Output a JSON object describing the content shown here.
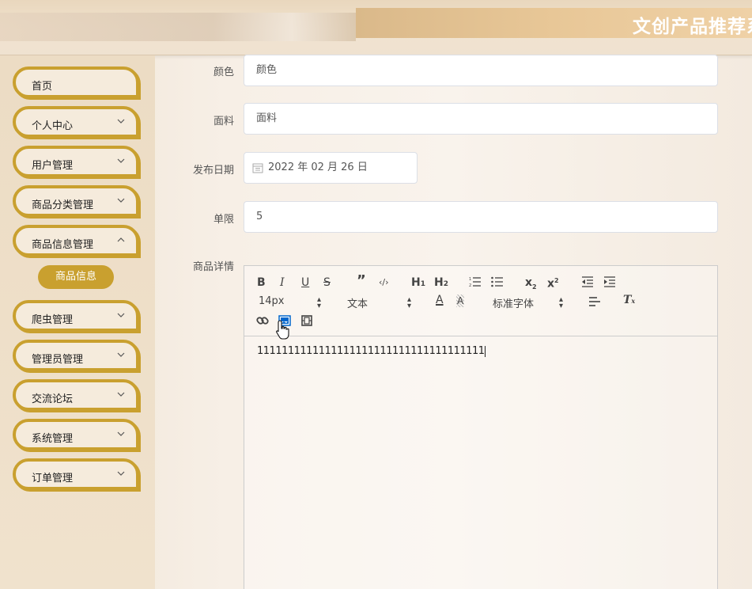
{
  "header": {
    "title": "文创产品推荐系统"
  },
  "sidebar": {
    "items": [
      {
        "label": "首页",
        "has_arrow": false
      },
      {
        "label": "个人中心",
        "has_arrow": true
      },
      {
        "label": "用户管理",
        "has_arrow": true
      },
      {
        "label": "商品分类管理",
        "has_arrow": true
      },
      {
        "label": "商品信息管理",
        "has_arrow": true
      },
      {
        "label": "爬虫管理",
        "has_arrow": true
      },
      {
        "label": "管理员管理",
        "has_arrow": true
      },
      {
        "label": "交流论坛",
        "has_arrow": true
      },
      {
        "label": "系统管理",
        "has_arrow": true
      },
      {
        "label": "订单管理",
        "has_arrow": true
      }
    ],
    "sub_item": "商品信息"
  },
  "form": {
    "color": {
      "label": "颜色",
      "value": "颜色"
    },
    "fabric": {
      "label": "面料",
      "value": "面料"
    },
    "release_date": {
      "label": "发布日期",
      "value": "2022 年 02 月 26 日"
    },
    "limit": {
      "label": "单限",
      "value": "5"
    },
    "detail": {
      "label": "商品详情"
    }
  },
  "editor": {
    "font_size": "14px",
    "paragraph": "文本",
    "font_family": "标准字体",
    "content": "1111111111111111111111111111111111111"
  },
  "colors": {
    "accent": "#c9a02f",
    "sidebar_bg": "#ecdcc4"
  }
}
